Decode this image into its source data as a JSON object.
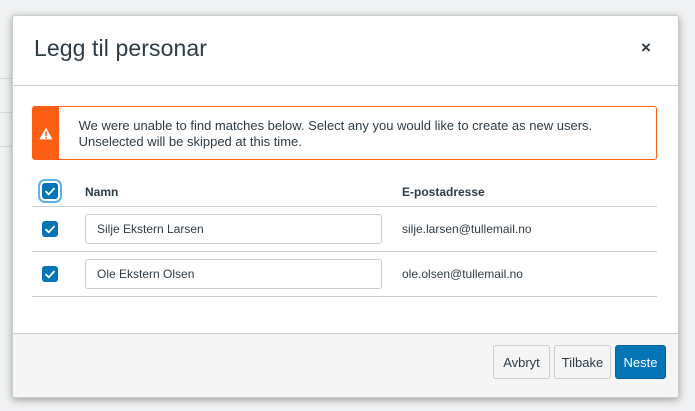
{
  "modal": {
    "title": "Legg til personar",
    "close_label": "×"
  },
  "alert": {
    "icon": "warning-icon",
    "message": "We were unable to find matches below. Select any you would like to create as new users. Unselected will be skipped at this time."
  },
  "table": {
    "headers": {
      "name": "Namn",
      "email": "E-postadresse"
    },
    "select_all_checked": true,
    "rows": [
      {
        "checked": true,
        "name": "Silje Ekstern Larsen",
        "email": "silje.larsen@tullemail.no"
      },
      {
        "checked": true,
        "name": "Ole Ekstern Olsen",
        "email": "ole.olsen@tullemail.no"
      }
    ]
  },
  "footer": {
    "cancel_label": "Avbryt",
    "back_label": "Tilbake",
    "next_label": "Neste"
  },
  "colors": {
    "primary": "#0374b5",
    "warning": "#fc5e13"
  }
}
